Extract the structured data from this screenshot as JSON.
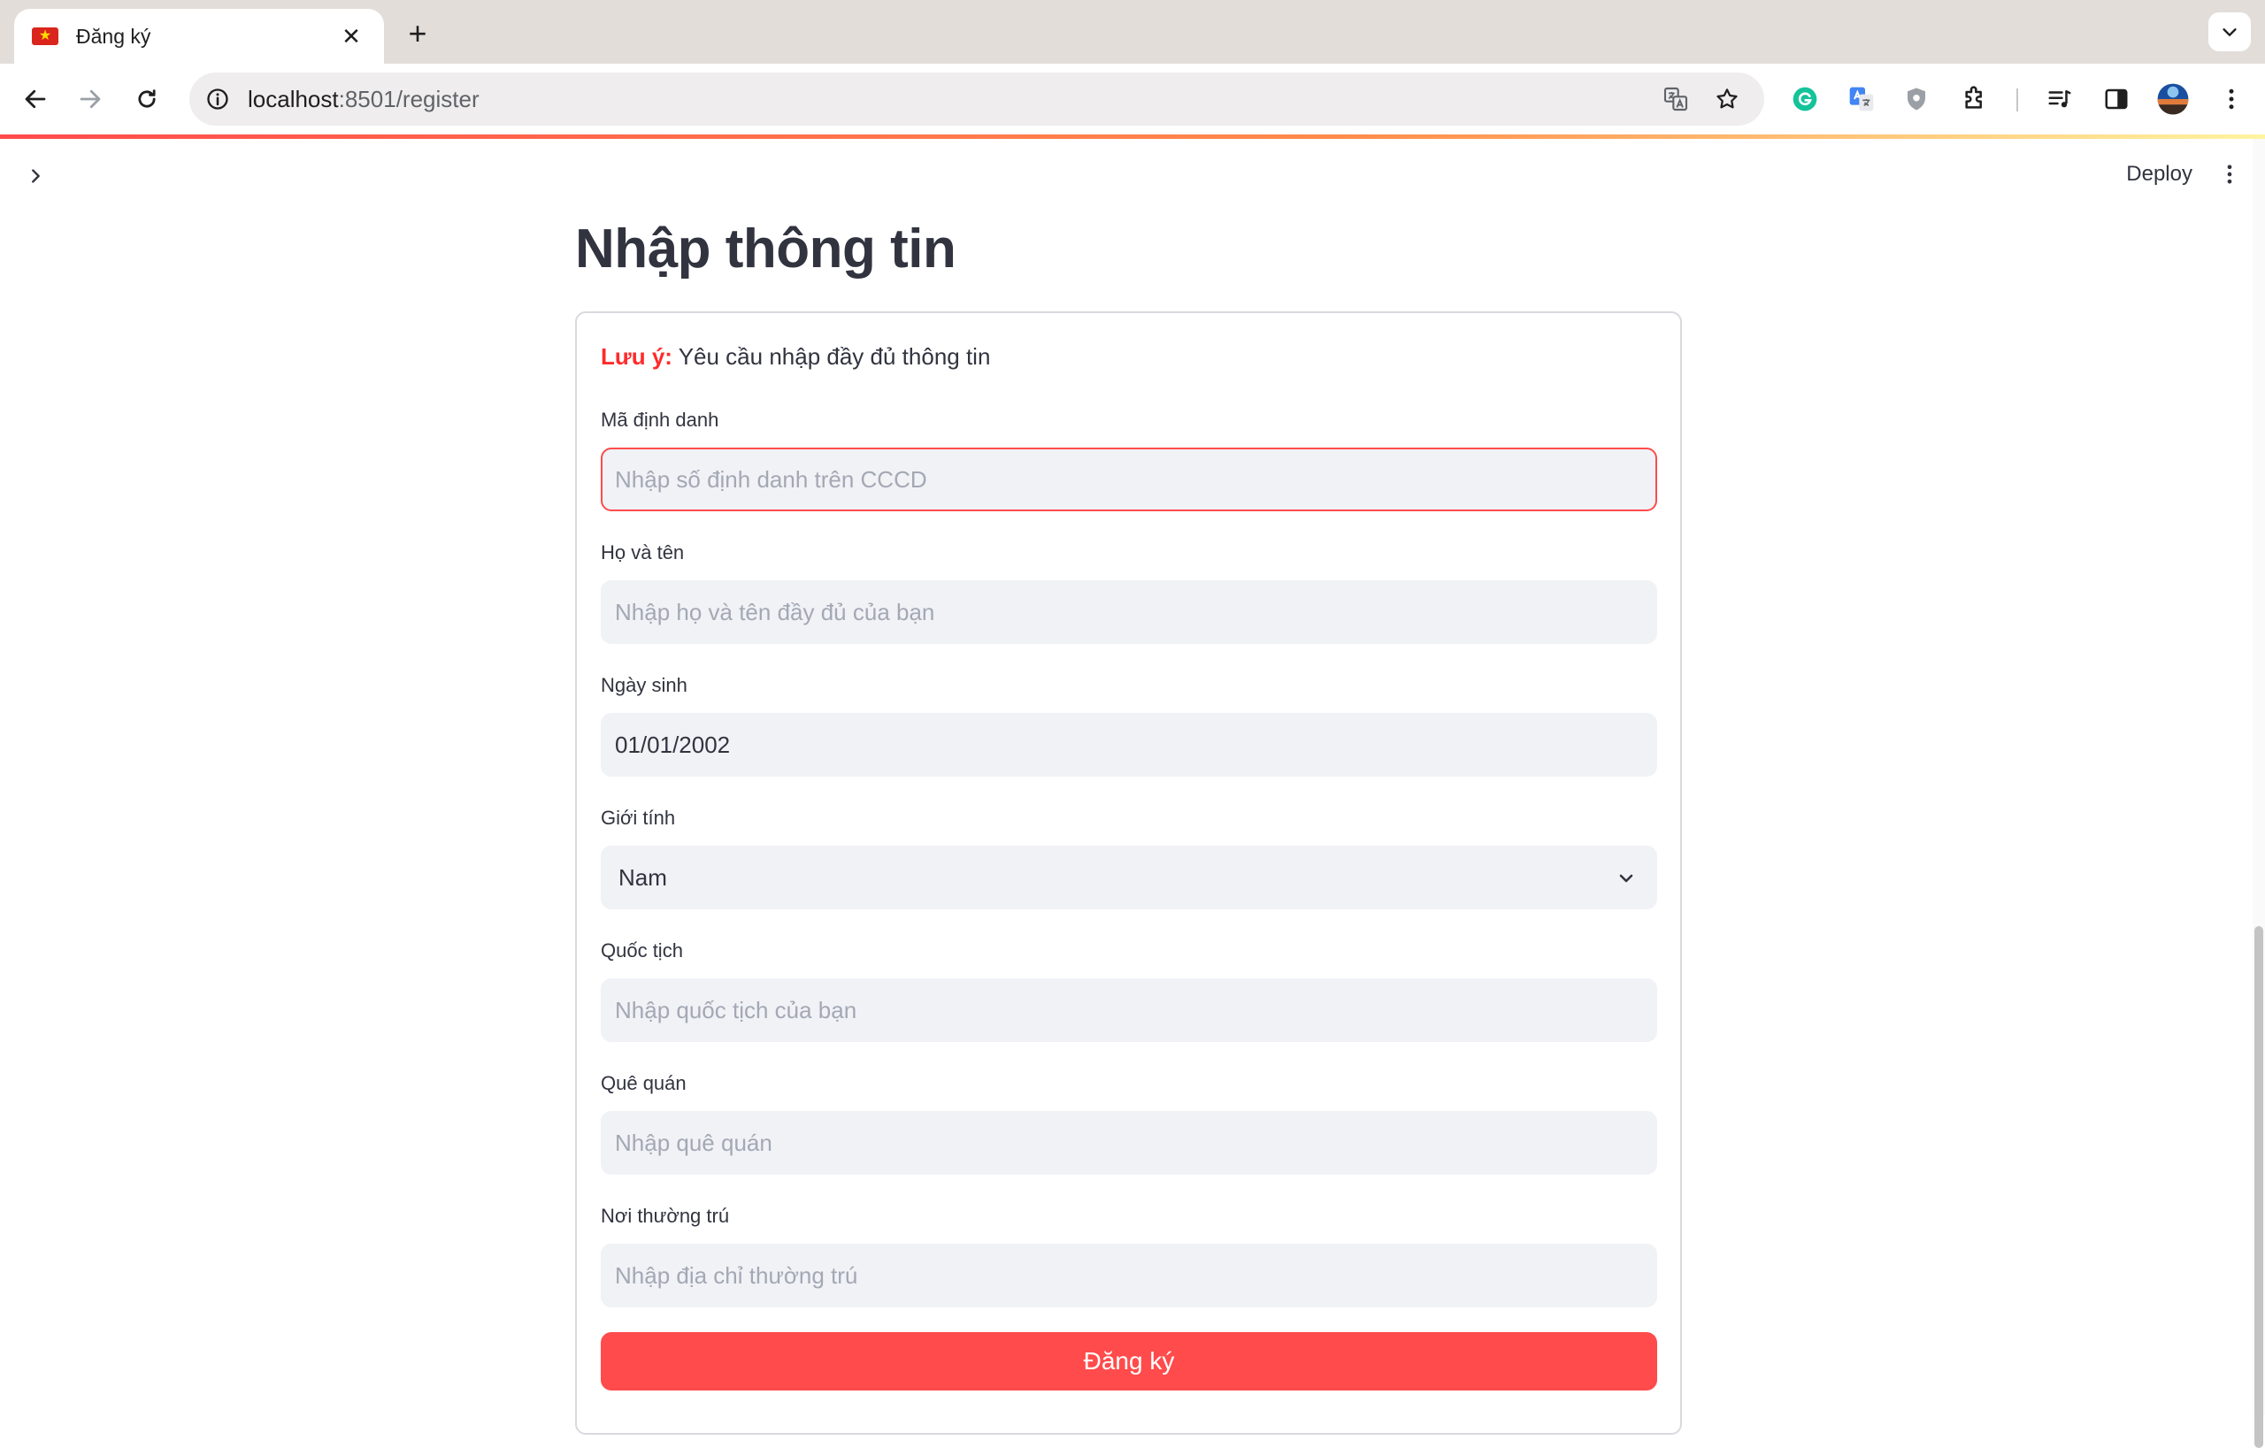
{
  "browser": {
    "tab_title": "Đăng ký",
    "tab_flag_symbol": "★",
    "new_tab_symbol": "+",
    "close_symbol": "✕",
    "url_host": "localhost",
    "url_path": ":8501/register"
  },
  "app": {
    "deploy_label": "Deploy",
    "page_title": "Nhập thông tin",
    "note_prefix": "Lưu ý:",
    "note_text": " Yêu cầu nhập đầy đủ thông tin",
    "fields": {
      "id_number": {
        "label": "Mã định danh",
        "placeholder": "Nhập số định danh trên CCCD",
        "value": ""
      },
      "full_name": {
        "label": "Họ và tên",
        "placeholder": "Nhập họ và tên đầy đủ của bạn",
        "value": ""
      },
      "birth_date": {
        "label": "Ngày sinh",
        "value": "01/01/2002"
      },
      "gender": {
        "label": "Giới tính",
        "value": "Nam"
      },
      "nationality": {
        "label": "Quốc tịch",
        "placeholder": "Nhập quốc tịch của bạn",
        "value": ""
      },
      "hometown": {
        "label": "Quê quán",
        "placeholder": "Nhập quê quán",
        "value": ""
      },
      "residence": {
        "label": "Nơi thường trú",
        "placeholder": "Nhập địa chỉ thường trú",
        "value": ""
      }
    },
    "submit_label": "Đăng ký"
  },
  "colors": {
    "accent": "#ff4b4b",
    "error_border": "#ff4b4b",
    "note_highlight": "#ff2b2b",
    "input_bg": "#f0f2f6"
  }
}
